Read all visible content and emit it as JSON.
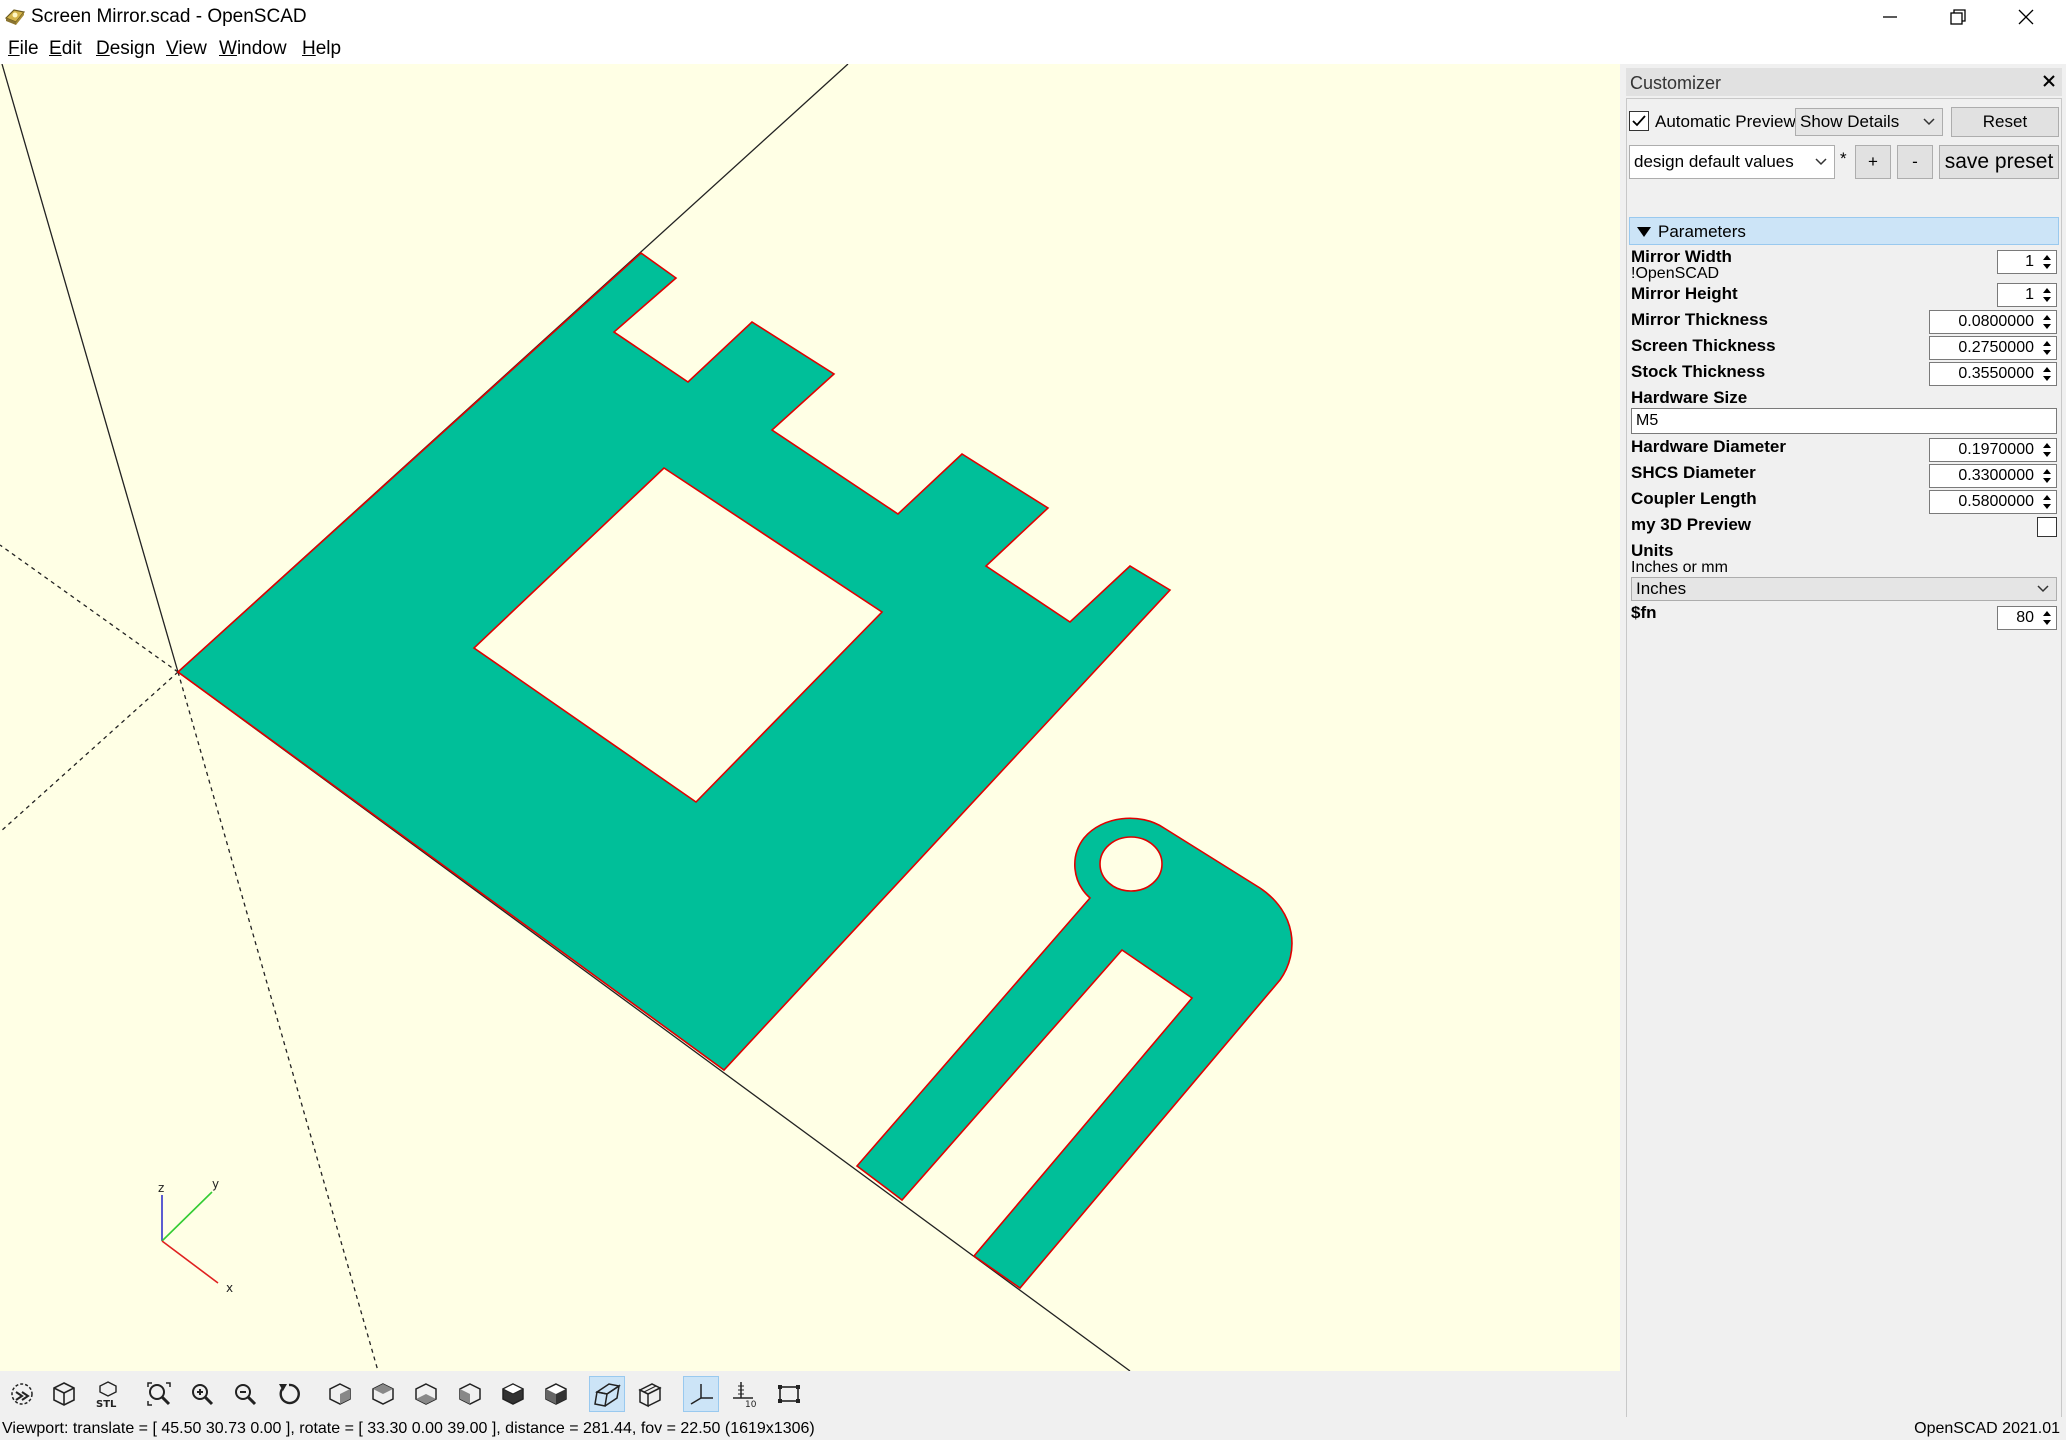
{
  "window": {
    "title": "Screen Mirror.scad - OpenSCAD"
  },
  "menu": {
    "items": [
      "File",
      "Edit",
      "Design",
      "View",
      "Window",
      "Help"
    ]
  },
  "colors": {
    "viewport_bg": "#ffffe5",
    "model_fill": "#00bf99",
    "model_outline": "#e00000",
    "accent": "#cce4f7"
  },
  "axes_gizmo": {
    "x_label": "x",
    "y_label": "y",
    "z_label": "z"
  },
  "toolbar": {
    "tools": [
      {
        "name": "preview-icon",
        "active": false
      },
      {
        "name": "render-icon",
        "active": false
      },
      {
        "name": "export-stl-icon",
        "active": false
      },
      {
        "name": "view-all-icon",
        "active": false
      },
      {
        "name": "zoom-in-icon",
        "active": false
      },
      {
        "name": "zoom-out-icon",
        "active": false
      },
      {
        "name": "reset-view-icon",
        "active": false
      },
      {
        "name": "view-right-icon",
        "active": false
      },
      {
        "name": "view-top-icon",
        "active": false
      },
      {
        "name": "view-bottom-icon",
        "active": false
      },
      {
        "name": "view-left-icon",
        "active": false
      },
      {
        "name": "view-front-icon",
        "active": false
      },
      {
        "name": "view-back-icon",
        "active": false
      },
      {
        "name": "perspective-icon",
        "active": true
      },
      {
        "name": "orthogonal-icon",
        "active": false
      },
      {
        "name": "show-axes-icon",
        "active": true
      },
      {
        "name": "show-scale-markers-icon",
        "active": false
      },
      {
        "name": "show-edges-icon",
        "active": false
      }
    ]
  },
  "status": {
    "viewport": "Viewport: translate = [ 45.50 30.73 0.00 ], rotate = [ 33.30 0.00 39.00 ], distance = 281.44, fov = 22.50 (1619x1306)",
    "version": "OpenSCAD 2021.01"
  },
  "customizer": {
    "title": "Customizer",
    "automatic_preview_label": "Automatic Preview",
    "automatic_preview_checked": true,
    "details_select": "Show Details",
    "reset_label": "Reset",
    "preset_select": "design default values",
    "preset_modified_marker": "*",
    "add_preset_label": "+",
    "remove_preset_label": "-",
    "save_preset_label": "save preset",
    "group_label": "Parameters",
    "params": {
      "mirror_width": {
        "name": "Mirror Width",
        "desc": "!OpenSCAD",
        "value": "1"
      },
      "mirror_height": {
        "name": "Mirror Height",
        "value": "1"
      },
      "mirror_thickness": {
        "name": "Mirror Thickness",
        "value": "0.0800000"
      },
      "screen_thickness": {
        "name": "Screen Thickness",
        "value": "0.2750000"
      },
      "stock_thickness": {
        "name": "Stock Thickness",
        "value": "0.3550000"
      },
      "hardware_size": {
        "name": "Hardware Size",
        "value": "M5"
      },
      "hardware_diameter": {
        "name": "Hardware Diameter",
        "value": "0.1970000"
      },
      "shcs_diameter": {
        "name": "SHCS Diameter",
        "value": "0.3300000"
      },
      "coupler_length": {
        "name": "Coupler Length",
        "value": "0.5800000"
      },
      "my_3d_preview": {
        "name": "my 3D Preview",
        "checked": false
      },
      "units": {
        "name": "Units",
        "desc": "Inches or mm",
        "value": "Inches"
      },
      "fn": {
        "name": "$fn",
        "value": "80"
      }
    }
  }
}
